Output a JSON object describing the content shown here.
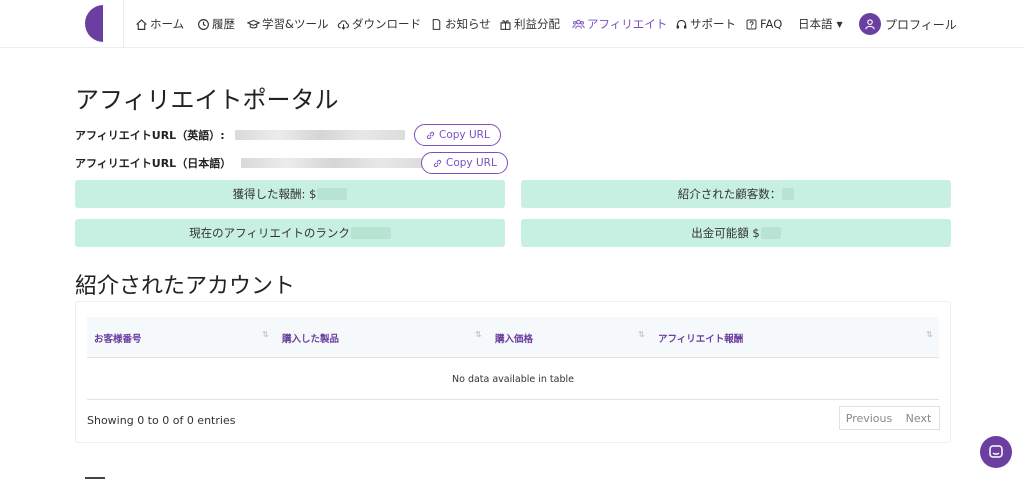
{
  "header": {
    "nav": [
      {
        "label": "ホーム",
        "icon": "home-icon"
      },
      {
        "label": "履歴",
        "icon": "clock-icon"
      },
      {
        "label": "学習&ツール",
        "icon": "graduation-cap-icon"
      },
      {
        "label": "ダウンロード",
        "icon": "cloud-download-icon"
      },
      {
        "label": "お知らせ",
        "icon": "document-icon"
      },
      {
        "label": "利益分配",
        "icon": "gift-icon"
      },
      {
        "label": "アフィリエイト",
        "icon": "users-icon",
        "active": true
      },
      {
        "label": "サポート",
        "icon": "headset-icon"
      },
      {
        "label": "FAQ",
        "icon": "question-icon"
      }
    ],
    "language": "日本語",
    "profile": "プロフィール"
  },
  "main": {
    "title": "アフィリエイトポータル",
    "url_en_label": "アフィリエイトURL（英語）:",
    "url_ja_label": "アフィリエイトURL（日本語）",
    "copy_label": "Copy URL",
    "stats": {
      "earned": "獲得した報酬: $",
      "referred": "紹介された顧客数：",
      "rank": "現在のアフィリエイトのランク",
      "withdrawable": "出金可能額 $"
    },
    "section_title": "紹介されたアカウント",
    "table": {
      "columns": [
        "お客様番号",
        "購入した製品",
        "購入価格",
        "アフィリエイト報酬"
      ],
      "empty": "No data available in table",
      "info": "Showing 0 to 0 of 0 entries",
      "previous": "Previous",
      "next": "Next"
    }
  },
  "colors": {
    "brand": "#6b3fa0",
    "active_nav": "#7a4fc0",
    "stat_bg": "#c8f0e2"
  }
}
